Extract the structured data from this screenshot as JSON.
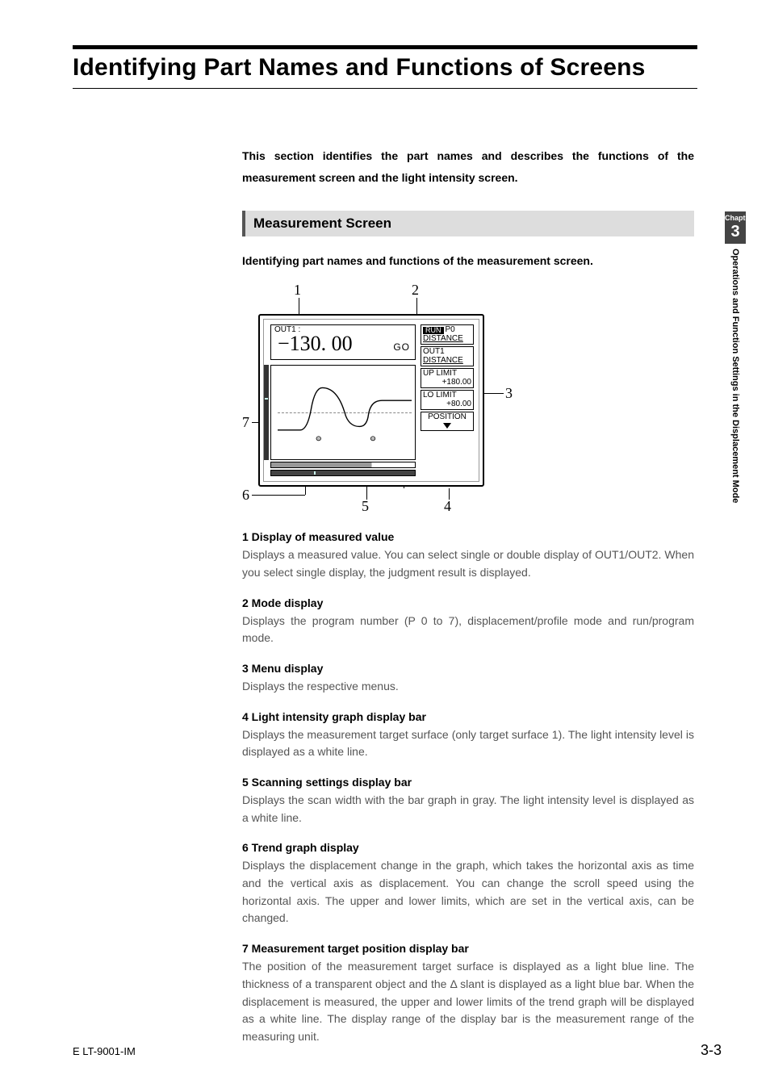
{
  "title": "Identifying Part Names and Functions of Screens",
  "intro": "This section identifies the part names and describes the functions of the measurement screen and the light intensity screen.",
  "section_heading": "Measurement Screen",
  "sub_intro": "Identifying part names and functions of the measurement screen.",
  "callouts": {
    "c1": "1",
    "c2": "2",
    "c3": "3",
    "c4": "4",
    "c5": "5",
    "c6": "6",
    "c7": "7"
  },
  "device": {
    "out_label": "OUT1 :",
    "value": "−130. 00",
    "go": "GO",
    "side": {
      "run": "RUN",
      "p0": "P0",
      "distance": "DISTANCE",
      "out1": "OUT1",
      "out1_sub": "DISTANCE",
      "uplimit": "UP LIMIT",
      "uplimit_val": "+180.00",
      "lolimit": "LO LIMIT",
      "lolimit_val": "+80.00",
      "position": "POSITION"
    }
  },
  "items": [
    {
      "title": "1 Display of measured value",
      "body": "Displays a measured value. You can select single or double display of OUT1/OUT2. When you select single display, the judgment result is displayed."
    },
    {
      "title": "2 Mode display",
      "body": "Displays the program number (P 0 to 7), displacement/profile mode and run/program mode."
    },
    {
      "title": "3 Menu display",
      "body": "Displays the respective menus."
    },
    {
      "title": "4 Light intensity graph display bar",
      "body": "Displays the measurement target surface (only target surface 1). The light intensity level is displayed as a white line."
    },
    {
      "title": "5 Scanning settings display bar",
      "body": "Displays the scan width with the bar graph in gray. The light intensity level is displayed as a white line."
    },
    {
      "title": "6 Trend graph display",
      "body": "Displays the displacement change in the graph, which takes the horizontal axis as time and the vertical axis as displacement. You can change the scroll speed using the horizontal axis. The upper and lower limits, which are set in the vertical axis, can be changed."
    },
    {
      "title": "7 Measurement target position display bar",
      "body": "The position of the measurement target surface is displayed as a light blue line. The thickness of a transparent object and the Δ slant is displayed as a light blue bar. When the displacement is measured, the upper and lower limits of the trend graph will be displayed as a white line. The display range of the display bar is the measurement range of the measuring unit."
    }
  ],
  "sidetab": {
    "chapter_label": "Chapter",
    "chapter_num": "3",
    "chapter_title": "Operations and Function Settings in the Displacement Mode"
  },
  "footer_left": "E LT-9001-IM",
  "footer_right": "3-3"
}
